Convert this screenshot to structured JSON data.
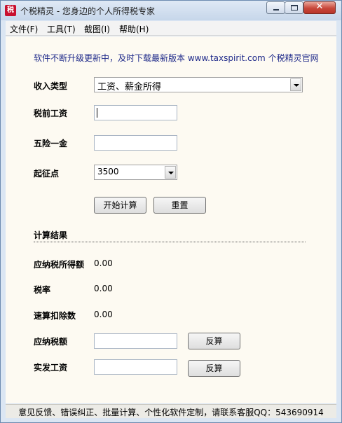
{
  "window": {
    "app_icon_text": "税",
    "title": "个税精灵 - 您身边的个人所得税专家",
    "controls": {
      "minimize": "minimize",
      "maximize": "maximize",
      "close": "✕"
    }
  },
  "menu": {
    "items": [
      "文件(F)",
      "工具(T)",
      "截图(I)",
      "帮助(H)"
    ]
  },
  "notice": "软件不断升级更新中，及时下载最新版本 www.taxspirit.com 个税精灵官网",
  "form": {
    "income_type_label": "收入类型",
    "income_type_value": "工资、薪金所得",
    "pretax_salary_label": "税前工资",
    "pretax_salary_value": "",
    "insurance_label": "五险一金",
    "insurance_value": "",
    "threshold_label": "起征点",
    "threshold_value": "3500",
    "calc_button": "开始计算",
    "reset_button": "重置"
  },
  "results": {
    "section_title": "计算结果",
    "taxable_income_label": "应纳税所得额",
    "taxable_income_value": "0.00",
    "tax_rate_label": "税率",
    "tax_rate_value": "0.00",
    "quick_deduction_label": "速算扣除数",
    "quick_deduction_value": "0.00",
    "tax_payable_label": "应纳税额",
    "tax_payable_value": "",
    "tax_payable_button": "反算",
    "net_salary_label": "实发工资",
    "net_salary_value": "",
    "net_salary_button": "反算"
  },
  "status_bar": "意见反馈、错误纠正、批量计算、个性化软件定制，请联系客服QQ：543690914",
  "colors": {
    "notice_text": "#1f2a8a",
    "content_bg": "#fdfaf2",
    "app_icon_bg": "#c8102e",
    "close_button": "#c8473a"
  }
}
